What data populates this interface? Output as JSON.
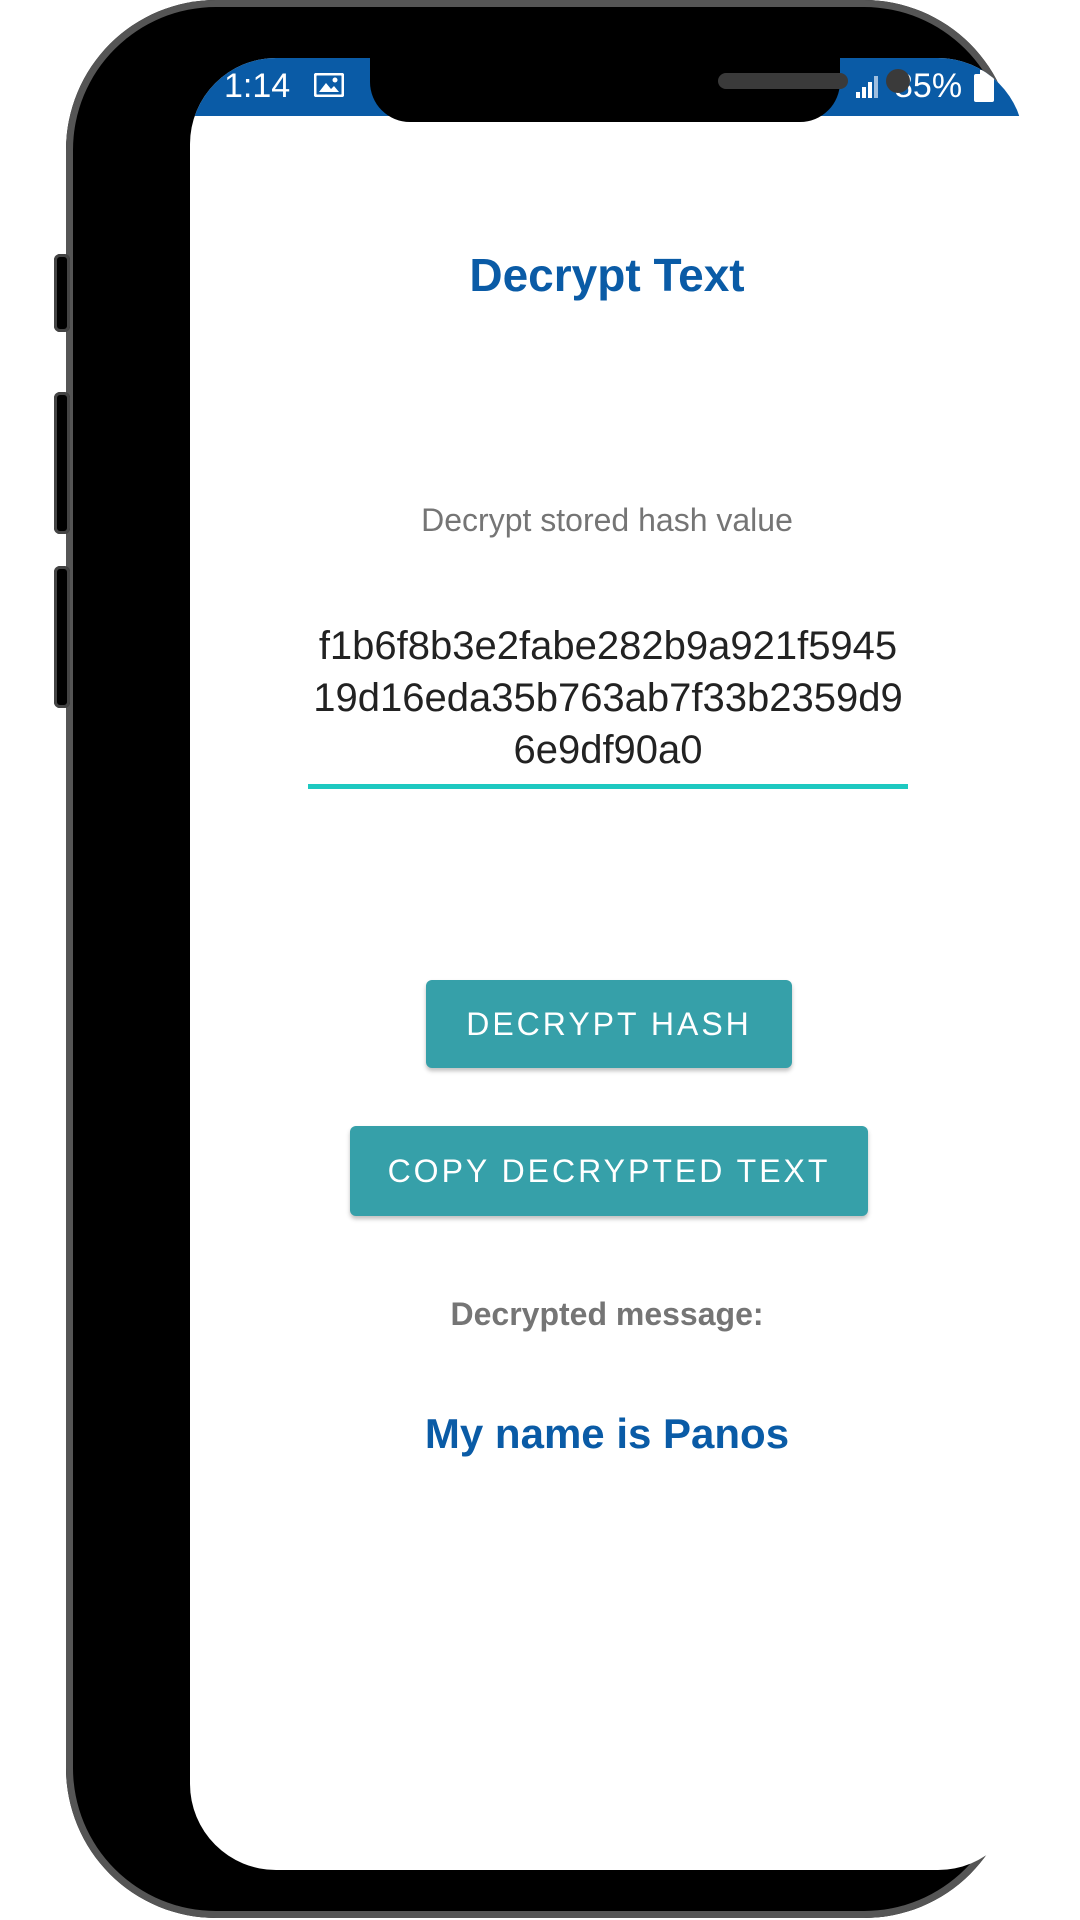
{
  "status_bar": {
    "time": "1:14",
    "battery": "85%",
    "background_color": "#0a5ba6",
    "icons": [
      "image-icon",
      "signal-icon",
      "battery-icon"
    ]
  },
  "screen": {
    "title": "Decrypt Text",
    "input_hint": "Decrypt stored hash value",
    "hash_value": "f1b6f8b3e2fabe282b9a921f594519d16eda35b763ab7f33b2359d96e9df90a0",
    "decrypt_button_label": "DECRYPT HASH",
    "copy_button_label": "COPY DECRYPTED TEXT",
    "result_label": "Decrypted message:",
    "result_value": "My name is Panos"
  },
  "colors": {
    "primary": "#0a5ba6",
    "button": "#36a0a9",
    "input_underline": "#1ec9c1",
    "secondary_text": "#757575"
  }
}
